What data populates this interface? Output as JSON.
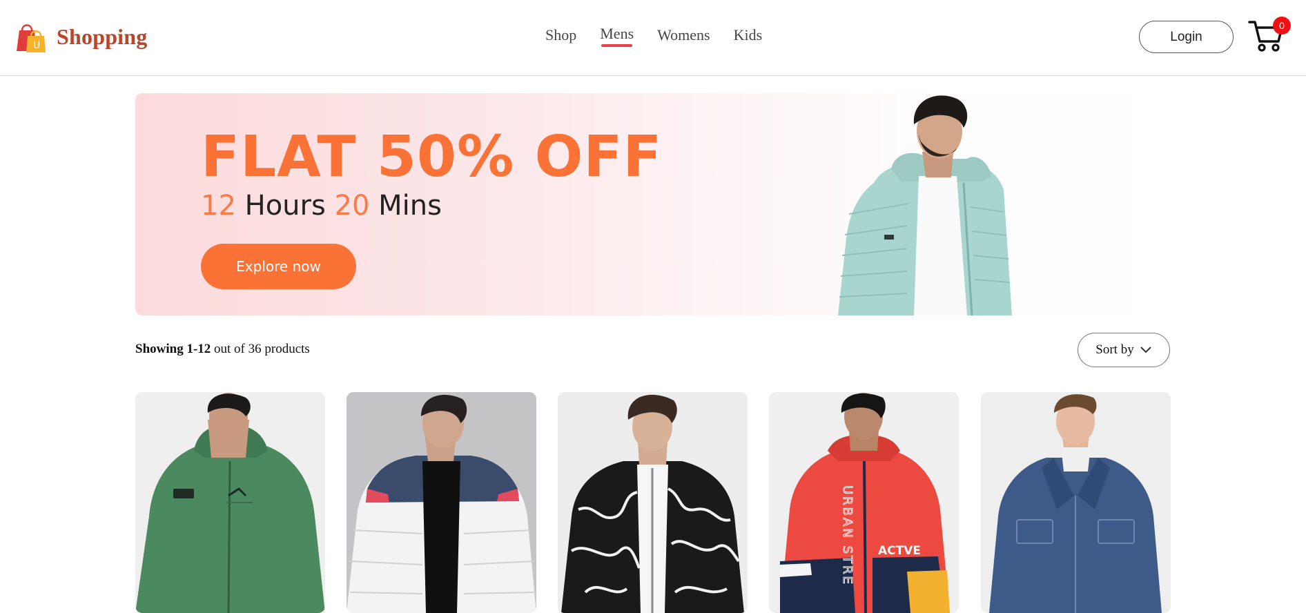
{
  "header": {
    "brand_name": "Shopping",
    "logo_letter": "U",
    "nav": [
      {
        "label": "Shop",
        "active": false
      },
      {
        "label": "Mens",
        "active": true
      },
      {
        "label": "Womens",
        "active": false
      },
      {
        "label": "Kids",
        "active": false
      }
    ],
    "login_label": "Login",
    "cart_count": "0"
  },
  "banner": {
    "headline": "FLAT 50% OFF",
    "hours_value": "12",
    "hours_label": "Hours",
    "mins_value": "20",
    "mins_label": "Mins",
    "cta_label": "Explore now"
  },
  "results": {
    "range": "Showing 1-12",
    "rest": "out of 36 products"
  },
  "sort": {
    "label": "Sort by"
  },
  "products": [
    {
      "jacket": "green-zip-hoodie"
    },
    {
      "jacket": "white-navy-puffer"
    },
    {
      "jacket": "black-white-marble-bomber"
    },
    {
      "jacket": "red-navy-colorblock-windbreaker",
      "print_1": "URBAN STRE",
      "print_2": "ACTVE"
    },
    {
      "jacket": "blue-denim-jacket"
    }
  ],
  "colors": {
    "brand": "#b5472c",
    "accent": "#fb7236",
    "nav_active_underline": "#ec3f4c",
    "badge": "#ee1111"
  }
}
